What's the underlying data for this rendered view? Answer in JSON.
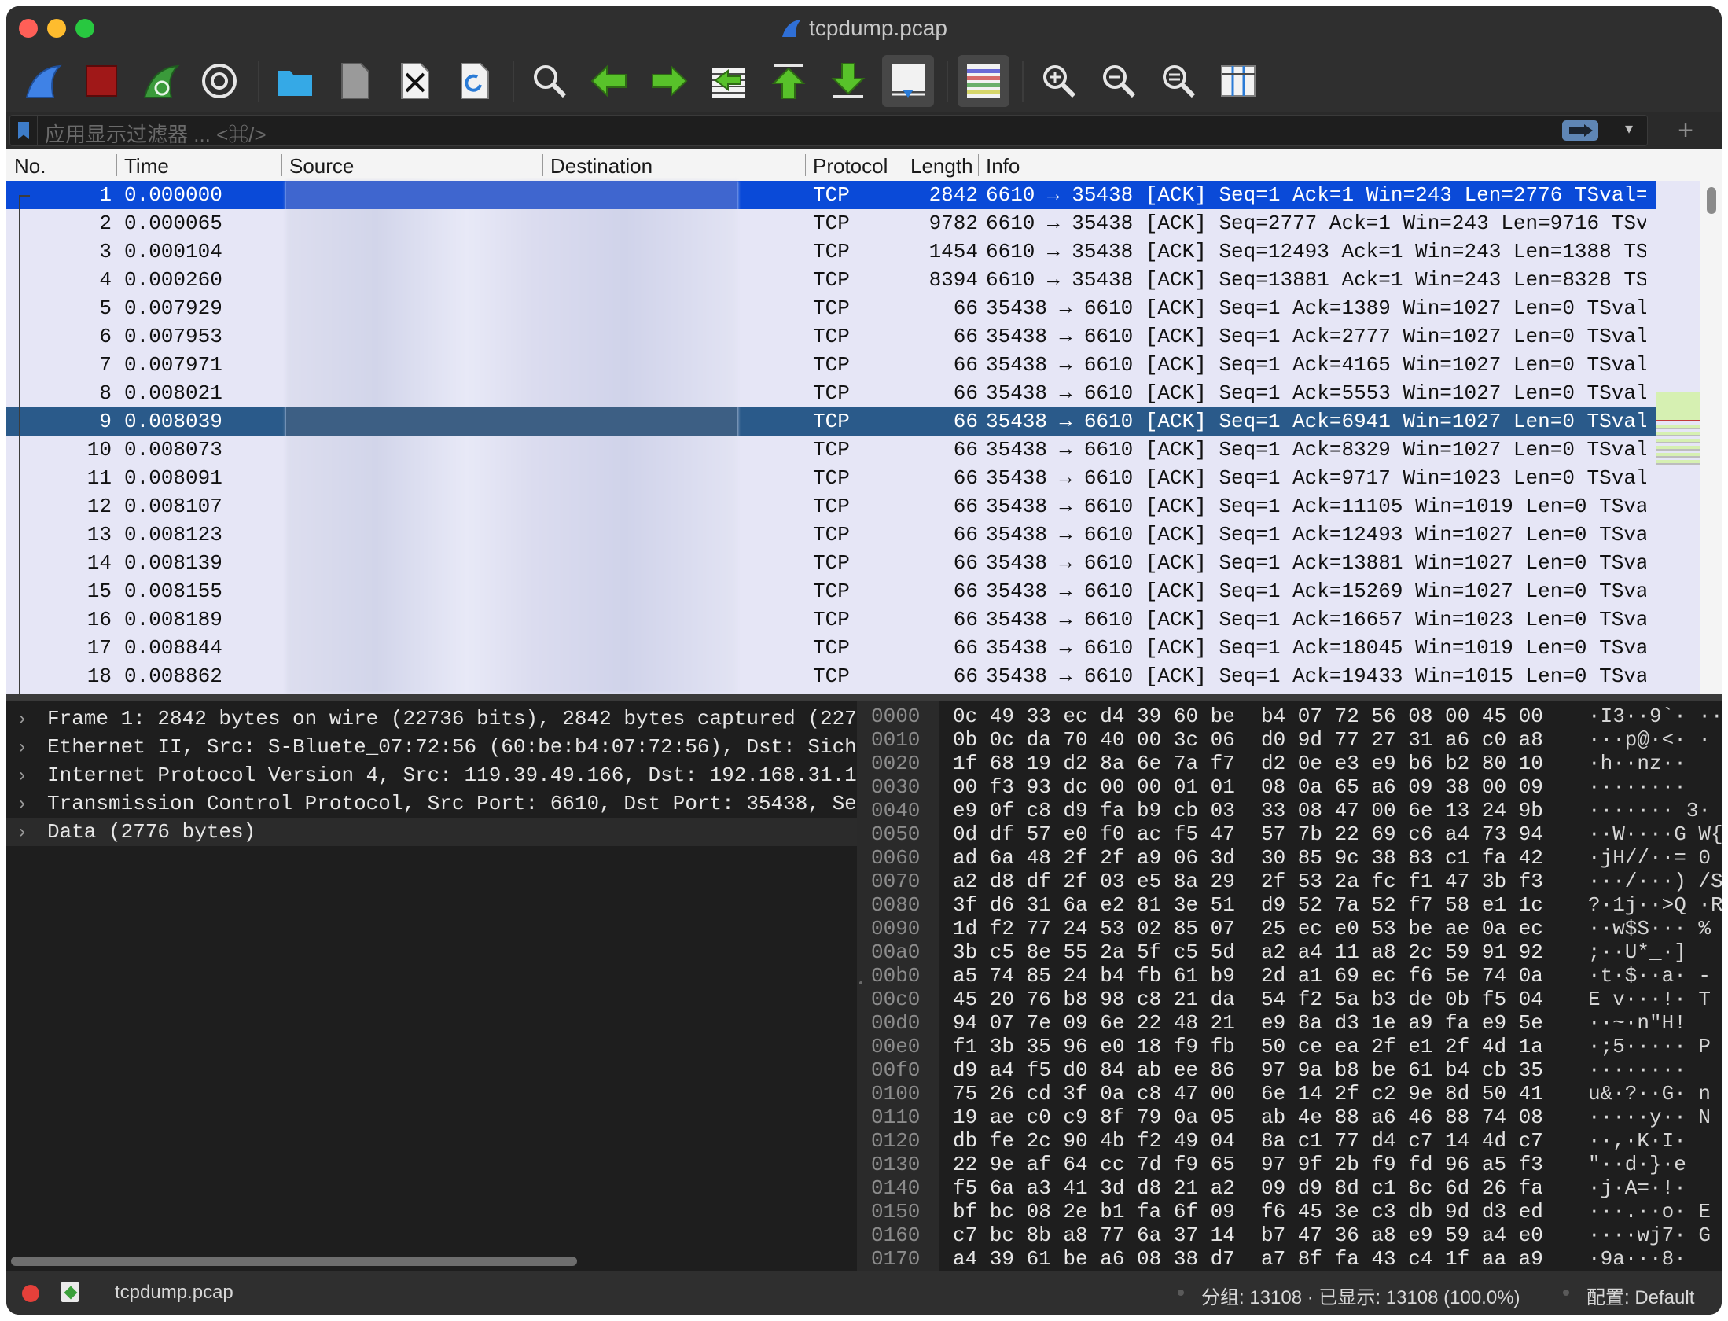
{
  "window": {
    "title": "tcpdump.pcap"
  },
  "toolbar": {
    "buttons": [
      {
        "name": "start-capture",
        "icon": "shark-fin-icon"
      },
      {
        "name": "stop-capture",
        "icon": "stop-square-icon"
      },
      {
        "name": "restart-capture",
        "icon": "restart-fin-icon"
      },
      {
        "name": "capture-options",
        "icon": "gear-icon"
      },
      {
        "name": "open-file",
        "icon": "folder-icon"
      },
      {
        "name": "save-file",
        "icon": "file-icon"
      },
      {
        "name": "close-file",
        "icon": "close-file-icon"
      },
      {
        "name": "reload-file",
        "icon": "reload-icon"
      },
      {
        "name": "find-packet",
        "icon": "magnifier-icon"
      },
      {
        "name": "go-back",
        "icon": "arrow-left-icon"
      },
      {
        "name": "go-forward",
        "icon": "arrow-right-icon"
      },
      {
        "name": "go-to-packet",
        "icon": "go-to-packet-icon"
      },
      {
        "name": "go-to-first",
        "icon": "arrow-to-top-icon"
      },
      {
        "name": "go-to-last",
        "icon": "arrow-to-bottom-icon"
      },
      {
        "name": "auto-scroll",
        "icon": "auto-scroll-icon"
      },
      {
        "name": "colorize",
        "icon": "colorize-icon"
      },
      {
        "name": "zoom-in",
        "icon": "zoom-in-icon"
      },
      {
        "name": "zoom-out",
        "icon": "zoom-out-icon"
      },
      {
        "name": "zoom-reset",
        "icon": "zoom-reset-icon"
      },
      {
        "name": "resize-columns",
        "icon": "resize-columns-icon"
      }
    ]
  },
  "filter": {
    "placeholder": "应用显示过滤器 ... <⌘/>",
    "plus": "+"
  },
  "columns": [
    "No.",
    "Time",
    "Source",
    "Destination",
    "Protocol",
    "Length",
    "Info"
  ],
  "packets": [
    {
      "no": "1",
      "time": "0.000000",
      "protocol": "TCP",
      "length": "2842",
      "info": "6610 → 35438 [ACK] Seq=1 Ack=1 Win=243 Len=2776 TSval="
    },
    {
      "no": "2",
      "time": "0.000065",
      "protocol": "TCP",
      "length": "9782",
      "info": "6610 → 35438 [ACK] Seq=2777 Ack=1 Win=243 Len=9716 TSv"
    },
    {
      "no": "3",
      "time": "0.000104",
      "protocol": "TCP",
      "length": "1454",
      "info": "6610 → 35438 [ACK] Seq=12493 Ack=1 Win=243 Len=1388 TS"
    },
    {
      "no": "4",
      "time": "0.000260",
      "protocol": "TCP",
      "length": "8394",
      "info": "6610 → 35438 [ACK] Seq=13881 Ack=1 Win=243 Len=8328 TS"
    },
    {
      "no": "5",
      "time": "0.007929",
      "protocol": "TCP",
      "length": "66",
      "info": "35438 → 6610 [ACK] Seq=1 Ack=1389 Win=1027 Len=0 TSval"
    },
    {
      "no": "6",
      "time": "0.007953",
      "protocol": "TCP",
      "length": "66",
      "info": "35438 → 6610 [ACK] Seq=1 Ack=2777 Win=1027 Len=0 TSval"
    },
    {
      "no": "7",
      "time": "0.007971",
      "protocol": "TCP",
      "length": "66",
      "info": "35438 → 6610 [ACK] Seq=1 Ack=4165 Win=1027 Len=0 TSval"
    },
    {
      "no": "8",
      "time": "0.008021",
      "protocol": "TCP",
      "length": "66",
      "info": "35438 → 6610 [ACK] Seq=1 Ack=5553 Win=1027 Len=0 TSval"
    },
    {
      "no": "9",
      "time": "0.008039",
      "protocol": "TCP",
      "length": "66",
      "info": "35438 → 6610 [ACK] Seq=1 Ack=6941 Win=1027 Len=0 TSval"
    },
    {
      "no": "10",
      "time": "0.008073",
      "protocol": "TCP",
      "length": "66",
      "info": "35438 → 6610 [ACK] Seq=1 Ack=8329 Win=1027 Len=0 TSval"
    },
    {
      "no": "11",
      "time": "0.008091",
      "protocol": "TCP",
      "length": "66",
      "info": "35438 → 6610 [ACK] Seq=1 Ack=9717 Win=1023 Len=0 TSval"
    },
    {
      "no": "12",
      "time": "0.008107",
      "protocol": "TCP",
      "length": "66",
      "info": "35438 → 6610 [ACK] Seq=1 Ack=11105 Win=1019 Len=0 TSva"
    },
    {
      "no": "13",
      "time": "0.008123",
      "protocol": "TCP",
      "length": "66",
      "info": "35438 → 6610 [ACK] Seq=1 Ack=12493 Win=1027 Len=0 TSva"
    },
    {
      "no": "14",
      "time": "0.008139",
      "protocol": "TCP",
      "length": "66",
      "info": "35438 → 6610 [ACK] Seq=1 Ack=13881 Win=1027 Len=0 TSva"
    },
    {
      "no": "15",
      "time": "0.008155",
      "protocol": "TCP",
      "length": "66",
      "info": "35438 → 6610 [ACK] Seq=1 Ack=15269 Win=1027 Len=0 TSva"
    },
    {
      "no": "16",
      "time": "0.008189",
      "protocol": "TCP",
      "length": "66",
      "info": "35438 → 6610 [ACK] Seq=1 Ack=16657 Win=1023 Len=0 TSva"
    },
    {
      "no": "17",
      "time": "0.008844",
      "protocol": "TCP",
      "length": "66",
      "info": "35438 → 6610 [ACK] Seq=1 Ack=18045 Win=1019 Len=0 TSva"
    },
    {
      "no": "18",
      "time": "0.008862",
      "protocol": "TCP",
      "length": "66",
      "info": "35438 → 6610 [ACK] Seq=1 Ack=19433 Win=1015 Len=0 TSva"
    }
  ],
  "details": [
    "Frame 1: 2842 bytes on wire (22736 bits), 2842 bytes captured (227",
    "Ethernet II, Src: S-Bluete_07:72:56 (60:be:b4:07:72:56), Dst: Sich",
    "Internet Protocol Version 4, Src: 119.39.49.166, Dst: 192.168.31.1",
    "Transmission Control Protocol, Src Port: 6610, Dst Port: 35438, Se",
    "Data (2776 bytes)"
  ],
  "bytes": [
    {
      "off": "0000",
      "h1": "0c 49 33 ec d4 39 60 be",
      "h2": "b4 07 72 56 08 00 45 00",
      "asc": "·I3··9`·  ··"
    },
    {
      "off": "0010",
      "h1": "0b 0c da 70 40 00 3c 06",
      "h2": "d0 9d 77 27 31 a6 c0 a8",
      "asc": "···p@·<·  ·"
    },
    {
      "off": "0020",
      "h1": "1f 68 19 d2 8a 6e 7a f7",
      "h2": "d2 0e e3 e9 b6 b2 80 10",
      "asc": "·h··nz··"
    },
    {
      "off": "0030",
      "h1": "00 f3 93 dc 00 00 01 01",
      "h2": "08 0a 65 a6 09 38 00 09",
      "asc": "········"
    },
    {
      "off": "0040",
      "h1": "e9 0f c8 d9 fa b9 cb 03",
      "h2": "33 08 47 00 6e 13 24 9b",
      "asc": "·······  3·"
    },
    {
      "off": "0050",
      "h1": "0d df 57 e0 f0 ac f5 47",
      "h2": "57 7b 22 69 c6 a4 73 94",
      "asc": "··W····G W{\""
    },
    {
      "off": "0060",
      "h1": "ad 6a 48 2f 2f a9 06 3d",
      "h2": "30 85 9c 38 83 c1 fa 42",
      "asc": "·jH//··= 0"
    },
    {
      "off": "0070",
      "h1": "a2 d8 df 2f 03 e5 8a 29",
      "h2": "2f 53 2a fc f1 47 3b f3",
      "asc": "···/···) /S"
    },
    {
      "off": "0080",
      "h1": "3f d6 31 6a e2 81 3e 51",
      "h2": "d9 52 7a 52 f7 58 e1 1c",
      "asc": "?·1j··>Q ·R"
    },
    {
      "off": "0090",
      "h1": "1d f2 77 24 53 02 85 07",
      "h2": "25 ec e0 53 be ae 0a ec",
      "asc": "··w$S··· %"
    },
    {
      "off": "00a0",
      "h1": "3b c5 8e 55 2a 5f c5 5d",
      "h2": "a2 a4 11 a8 2c 59 91 92",
      "asc": ";··U*_·]"
    },
    {
      "off": "00b0",
      "h1": "a5 74 85 24 b4 fb 61 b9",
      "h2": "2d a1 69 ec f6 5e 74 0a",
      "asc": "·t·$··a· -"
    },
    {
      "off": "00c0",
      "h1": "45 20 76 b8 98 c8 21 da",
      "h2": "54 f2 5a b3 de 0b f5 04",
      "asc": "E v···!· T"
    },
    {
      "off": "00d0",
      "h1": "94 07 7e 09 6e 22 48 21",
      "h2": "e9 8a d3 1e a9 fa e9 5e",
      "asc": "··~·n\"H!"
    },
    {
      "off": "00e0",
      "h1": "f1 3b 35 96 e0 18 f9 fb",
      "h2": "50 ce ea 2f e1 2f 4d 1a",
      "asc": "·;5····· P"
    },
    {
      "off": "00f0",
      "h1": "d9 a4 f5 d0 84 ab ee 86",
      "h2": "97 9a b8 be 61 b4 cb 35",
      "asc": "········"
    },
    {
      "off": "0100",
      "h1": "75 26 cd 3f 0a c8 47 00",
      "h2": "6e 14 2f c2 9e 8d 50 41",
      "asc": "u&·?··G· n"
    },
    {
      "off": "0110",
      "h1": "19 ae c0 c9 8f 79 0a 05",
      "h2": "ab 4e 88 a6 46 88 74 08",
      "asc": "·····y·· N"
    },
    {
      "off": "0120",
      "h1": "db fe 2c 90 4b f2 49 04",
      "h2": "8a c1 77 d4 c7 14 4d c7",
      "asc": "··,·K·I·"
    },
    {
      "off": "0130",
      "h1": "22 9e af 64 cc 7d f9 65",
      "h2": "97 9f 2b f9 fd 96 a5 f3",
      "asc": "\"··d·}·e"
    },
    {
      "off": "0140",
      "h1": "f5 6a a3 41 3d d8 21 a2",
      "h2": "09 d9 8d c1 8c 6d 26 fa",
      "asc": "·j·A=·!·"
    },
    {
      "off": "0150",
      "h1": "bf bc 08 2e b1 fa 6f 09",
      "h2": "f6 45 3e c3 db 9d d3 ed",
      "asc": "···.··o· E"
    },
    {
      "off": "0160",
      "h1": "c7 bc 8b a8 77 6a 37 14",
      "h2": "b7 47 36 a8 e9 59 a4 e0",
      "asc": "····wj7· G"
    },
    {
      "off": "0170",
      "h1": "a4 39 61 be a6 08 38 d7",
      "h2": "a7 8f fa 43 c4 1f aa a9",
      "asc": "·9a···8·"
    }
  ],
  "status": {
    "file": "tcpdump.pcap",
    "stats": "分组: 13108 · 已显示: 13108 (100.0%)",
    "profile": "配置: Default"
  },
  "colors": {
    "selection": "#0a4ad8",
    "secondary_selection": "#2a5a8a",
    "packet_bg": "#e6e6f6"
  }
}
